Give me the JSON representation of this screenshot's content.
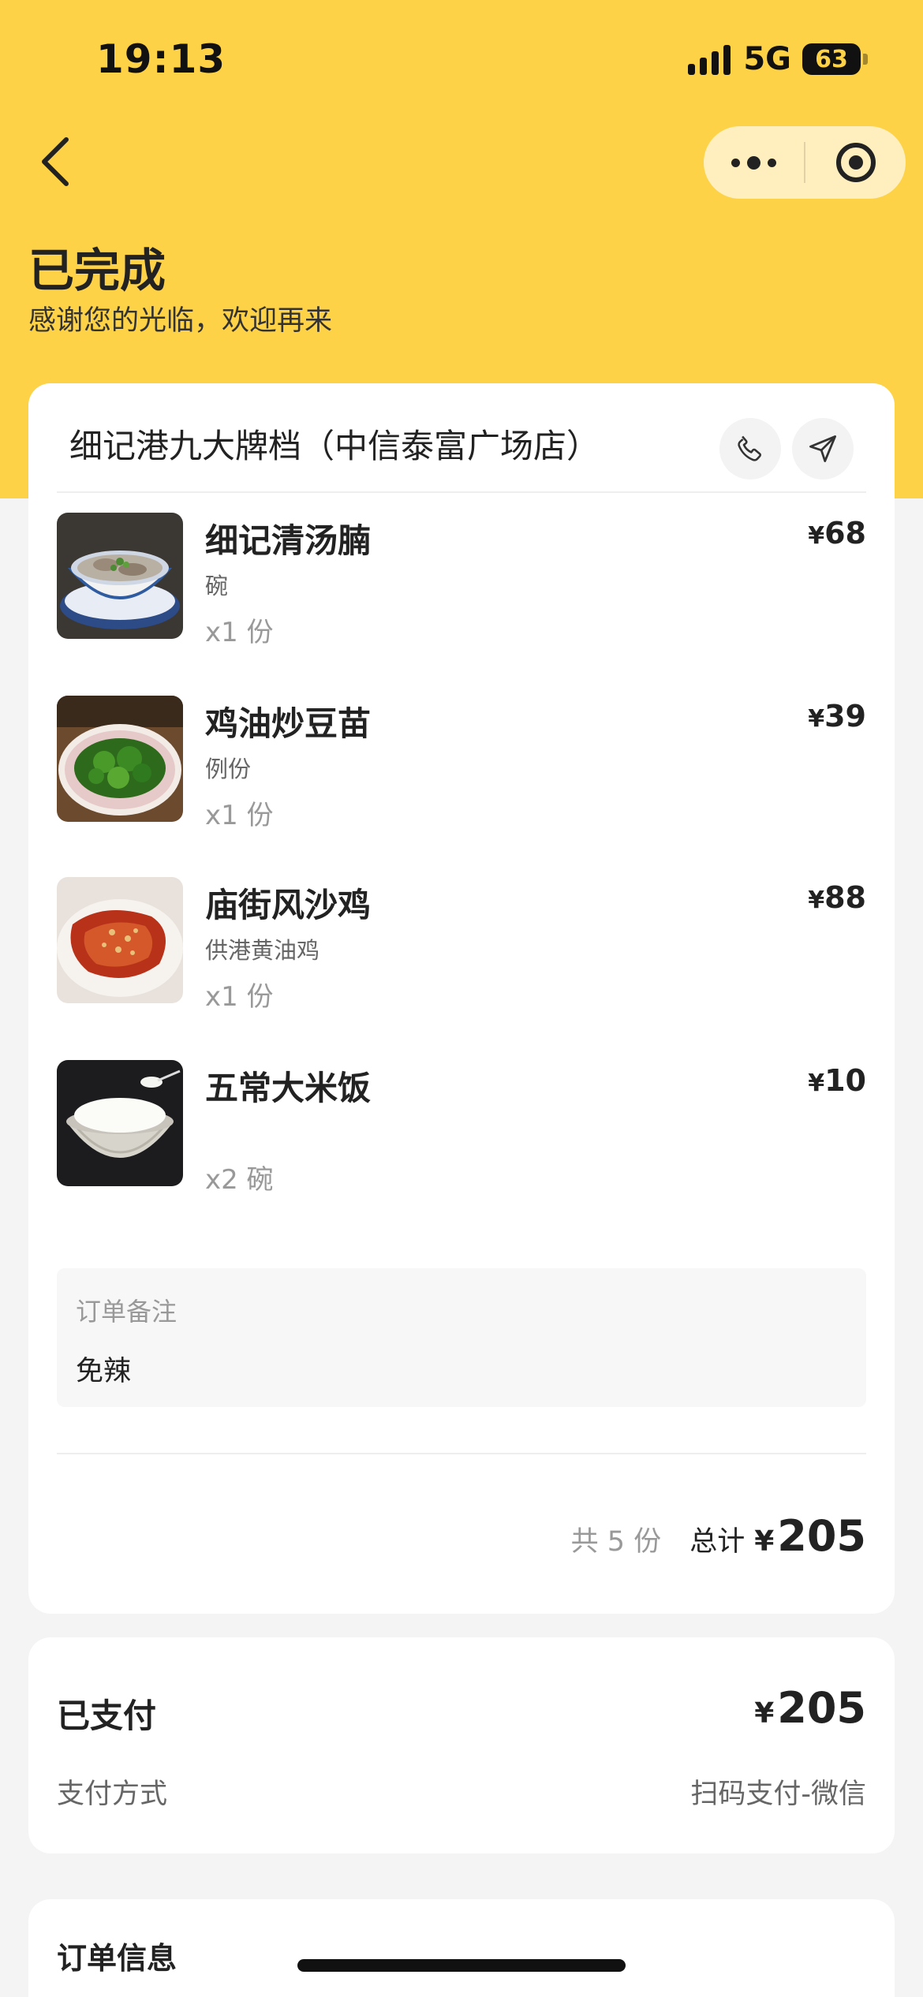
{
  "status_bar": {
    "time": "19:13",
    "network": "5G",
    "battery": "63"
  },
  "header": {
    "title": "已完成",
    "subtitle": "感谢您的光临，欢迎再来"
  },
  "store": {
    "name": "细记港九大牌档（中信泰富广场店）"
  },
  "items": [
    {
      "name": "细记清汤腩",
      "spec": "碗",
      "qty": "x1 份",
      "price": "68"
    },
    {
      "name": "鸡油炒豆苗",
      "spec": "例份",
      "qty": "x1 份",
      "price": "39"
    },
    {
      "name": "庙街风沙鸡",
      "spec": "供港黄油鸡",
      "qty": "x1 份",
      "price": "88"
    },
    {
      "name": "五常大米饭",
      "spec": "",
      "qty": "x2 碗",
      "price": "10"
    }
  ],
  "currency_symbol": "¥",
  "note": {
    "label": "订单备注",
    "text": "免辣"
  },
  "summary": {
    "count_text": "共 5 份",
    "total_label": "总计",
    "total": "205"
  },
  "payment": {
    "title": "已支付",
    "amount": "205",
    "method_label": "支付方式",
    "method_value": "扫码支付-微信"
  },
  "order_info": {
    "title": "订单信息"
  },
  "colors": {
    "accent": "#fed247",
    "background": "#f4f4f4"
  }
}
